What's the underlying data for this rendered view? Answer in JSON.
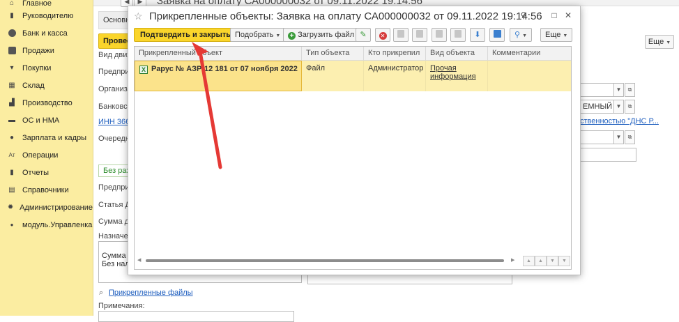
{
  "sidebar": {
    "items": [
      {
        "label": "Главное",
        "icon": "home-icon"
      },
      {
        "label": "Руководителю",
        "icon": "chart-icon"
      },
      {
        "label": "Банк и касса",
        "icon": "bank-icon"
      },
      {
        "label": "Продажи",
        "icon": "bag-icon"
      },
      {
        "label": "Покупки",
        "icon": "cart-icon"
      },
      {
        "label": "Склад",
        "icon": "warehouse-icon"
      },
      {
        "label": "Производство",
        "icon": "factory-icon"
      },
      {
        "label": "ОС и НМА",
        "icon": "truck-icon"
      },
      {
        "label": "Зарплата и кадры",
        "icon": "people-icon"
      },
      {
        "label": "Операции",
        "icon": "operations-icon"
      },
      {
        "label": "Отчеты",
        "icon": "report-icon"
      },
      {
        "label": "Справочники",
        "icon": "book-icon"
      },
      {
        "label": "Администрирование",
        "icon": "gear-icon"
      },
      {
        "label": "модуль.Управленка",
        "icon": "module-icon"
      }
    ]
  },
  "background_form": {
    "title": "Заявка на оплату СА000000032 от 09.11.2022 19:14:56",
    "tab_main": "Основн",
    "post_button": "Провес",
    "more_button": "Еще",
    "labels": {
      "vid": "Вид движ",
      "predpr1": "Предпри",
      "org": "Организ",
      "bank": "Банковс",
      "inn": "ИНН 366",
      "ochered": "Очередн",
      "bez_razd": "Без раз",
      "predpr2": "Предпри",
      "statya": "Статья ДД",
      "summa": "Сумма до",
      "naznach": "Назначен",
      "attached_files": "Прикрепленные файлы",
      "notes": "Примечания:"
    },
    "field_bank_value": "ЕМНЫЙ БА",
    "link_right": "ственностью \"ДНС Р...",
    "textarea_lines": [
      "Сумма 1",
      "Без нало"
    ]
  },
  "modal": {
    "title": "Прикрепленные объекты: Заявка на оплату СА000000032 от 09.11.2022 19:14:56",
    "toolbar": {
      "confirm_close": "Подтвердить и закрыть",
      "pick": "Подобрать",
      "upload": "Загрузить файл",
      "more": "Еще"
    },
    "table": {
      "columns": [
        "Прикрепленный объект",
        "Тип объекта",
        "Кто прикрепил",
        "Вид объекта",
        "Комментарии"
      ],
      "rows": [
        {
          "object": "Рарус № АЗР-12 181 от 07 ноября 2022",
          "type": "Файл",
          "who": "Администратор",
          "kind": "Прочая информация",
          "comment": ""
        }
      ]
    }
  },
  "colors": {
    "sidebar_bg": "#fbeda1",
    "primary_button": "#fad52b",
    "selected_row": "#fcefb0",
    "annotation_arrow": "#e53935",
    "link": "#1f5fbf"
  }
}
